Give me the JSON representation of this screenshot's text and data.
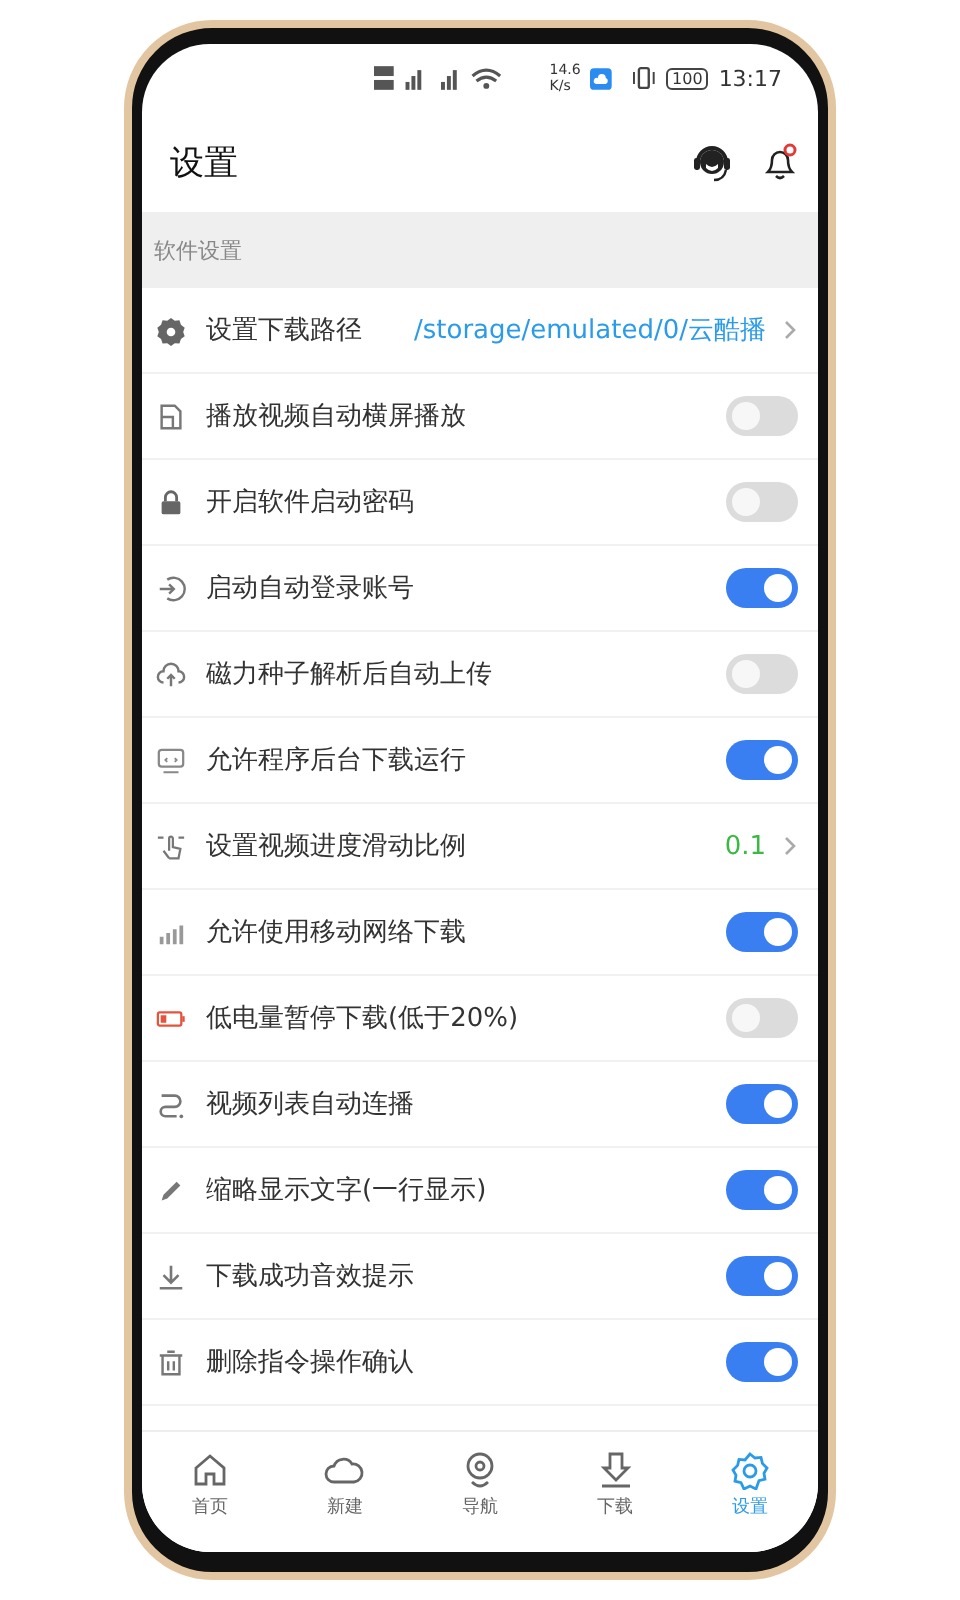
{
  "status_bar": {
    "speed": "14.6",
    "speed_unit": "K/s",
    "battery": "100",
    "time": "13:17"
  },
  "header": {
    "title": "设置"
  },
  "section": {
    "title": "软件设置"
  },
  "settings": [
    {
      "kind": "link",
      "label": "设置下载路径",
      "value": "/storage/emulated/0/云酷播",
      "color": "#2a9be8"
    },
    {
      "kind": "toggle",
      "label": "播放视频自动横屏播放",
      "on": false
    },
    {
      "kind": "toggle",
      "label": "开启软件启动密码",
      "on": false
    },
    {
      "kind": "toggle",
      "label": "启动自动登录账号",
      "on": true
    },
    {
      "kind": "toggle",
      "label": "磁力种子解析后自动上传",
      "on": false
    },
    {
      "kind": "toggle",
      "label": "允许程序后台下载运行",
      "on": true
    },
    {
      "kind": "link",
      "label": "设置视频进度滑动比例",
      "value": "0.1",
      "color": "#3cb846"
    },
    {
      "kind": "toggle",
      "label": "允许使用移动网络下载",
      "on": true
    },
    {
      "kind": "toggle",
      "label": "低电量暂停下载(低于20%)",
      "on": false
    },
    {
      "kind": "toggle",
      "label": "视频列表自动连播",
      "on": true
    },
    {
      "kind": "toggle",
      "label": "缩略显示文字(一行显示)",
      "on": true
    },
    {
      "kind": "toggle",
      "label": "下载成功音效提示",
      "on": true
    },
    {
      "kind": "toggle",
      "label": "删除指令操作确认",
      "on": true
    }
  ],
  "tabs": [
    {
      "label": "首页",
      "selected": false
    },
    {
      "label": "新建",
      "selected": false
    },
    {
      "label": "导航",
      "selected": false
    },
    {
      "label": "下载",
      "selected": false
    },
    {
      "label": "设置",
      "selected": true
    }
  ]
}
